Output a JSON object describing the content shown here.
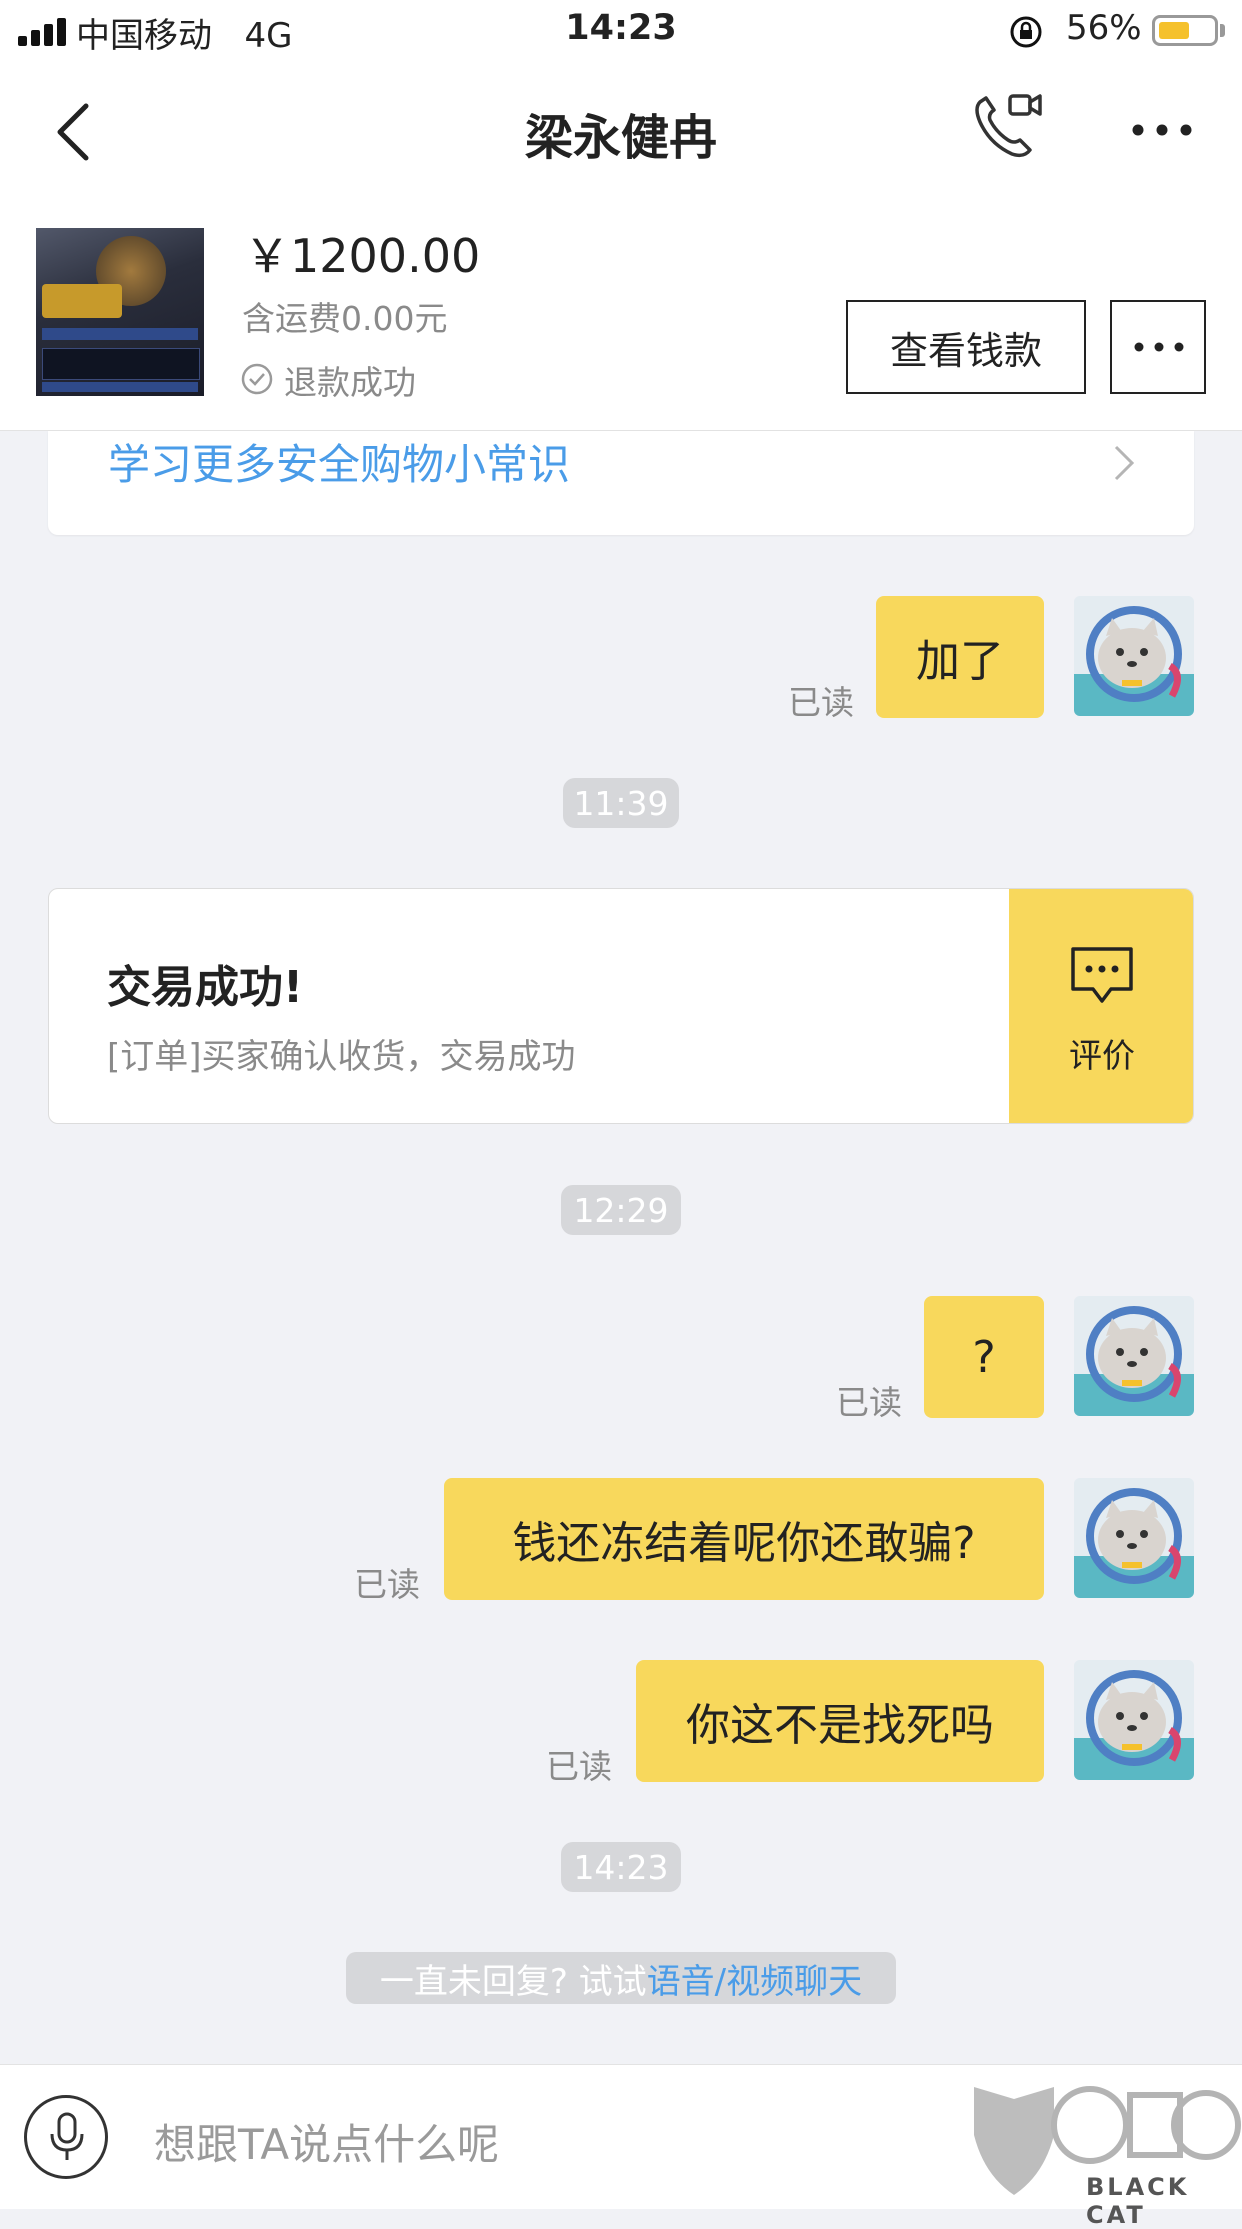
{
  "status_bar": {
    "carrier": "中国移动",
    "network": "4G",
    "time": "14:23",
    "battery_percent": "56%",
    "battery_level": 0.56
  },
  "nav": {
    "title": "梁永健冉",
    "back_icon": "chevron-left-icon",
    "call_icon": "video-call-icon",
    "more_icon": "more-dots-icon"
  },
  "product": {
    "price": "￥1200.00",
    "shipping": "含运费0.00元",
    "status": "退款成功",
    "view_button": "查看钱款"
  },
  "tips": {
    "text": "学习更多安全购物小常识"
  },
  "messages": {
    "m1": {
      "text": "加了",
      "read": "已读"
    },
    "ts1": "11:39",
    "trade": {
      "title": "交易成功!",
      "subtitle": "[订单]买家确认收货，交易成功",
      "action": "评价"
    },
    "ts2": "12:29",
    "m2": {
      "text": "?",
      "read": "已读"
    },
    "m3": {
      "text": "钱还冻结着呢你还敢骗?",
      "read": "已读"
    },
    "m4": {
      "text": "你这不是找死吗",
      "read": "已读"
    },
    "ts3": "14:23"
  },
  "hint": {
    "prefix": "一直未回复? 试试",
    "link": "语音/视频聊天"
  },
  "input": {
    "placeholder": "想跟TA说点什么呢"
  },
  "watermark": {
    "text": "BLACK CAT"
  },
  "colors": {
    "bubble": "#f8d85c",
    "link": "#4a9ce8",
    "background": "#f1f2f6"
  }
}
